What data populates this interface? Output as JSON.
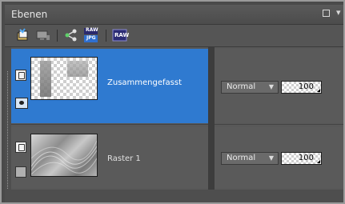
{
  "panel": {
    "title": "Ebenen"
  },
  "toolbar": {
    "buttons": [
      {
        "icon": "new-layer-icon"
      },
      {
        "icon": "layer-properties-icon"
      },
      {
        "icon": "share-icon"
      },
      {
        "icon": "raw-jpg-icon",
        "label_top": "RAW",
        "label_bottom": "JPG"
      },
      {
        "icon": "raw-icon",
        "label": "RAW"
      }
    ]
  },
  "layers": [
    {
      "name": "Zusammengefasst",
      "blend_mode": "Normal",
      "opacity": "100",
      "selected": true
    },
    {
      "name": "Raster 1",
      "blend_mode": "Normal",
      "opacity": "100",
      "selected": false
    }
  ],
  "colors": {
    "selected": "#2f7ad0",
    "panel_bg": "#525252"
  }
}
